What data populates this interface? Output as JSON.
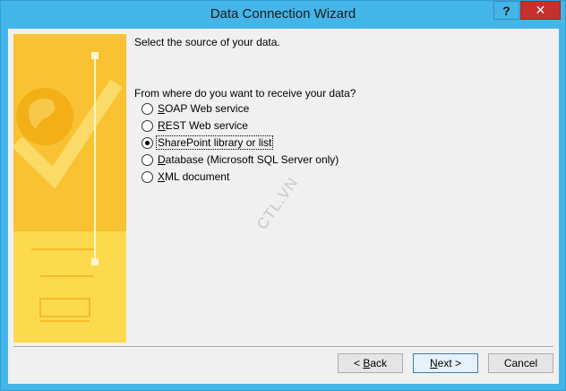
{
  "window": {
    "title": "Data Connection Wizard"
  },
  "titlebar": {
    "help_label": "?",
    "close_label": "✕"
  },
  "content": {
    "prompt": "Select the source of your data.",
    "question": "From where do you want to receive your data?",
    "options": [
      {
        "accel": "S",
        "rest": "OAP Web service",
        "selected": false
      },
      {
        "accel": "R",
        "rest": "EST Web service",
        "selected": false
      },
      {
        "accel": "",
        "pre": "SharePoint library or list",
        "selected": true
      },
      {
        "accel": "D",
        "rest": "atabase (Microsoft SQL Server only)",
        "selected": false
      },
      {
        "accel": "X",
        "rest": "ML document",
        "selected": false
      }
    ],
    "watermark": "CTL.VN"
  },
  "buttons": {
    "back_prefix": "< ",
    "back_accel": "B",
    "back_rest": "ack",
    "next_accel": "N",
    "next_rest": "ext >",
    "cancel": "Cancel"
  },
  "colors": {
    "title_bar": "#44b5e8",
    "close": "#c7312b",
    "banner": "#fbd24a"
  }
}
